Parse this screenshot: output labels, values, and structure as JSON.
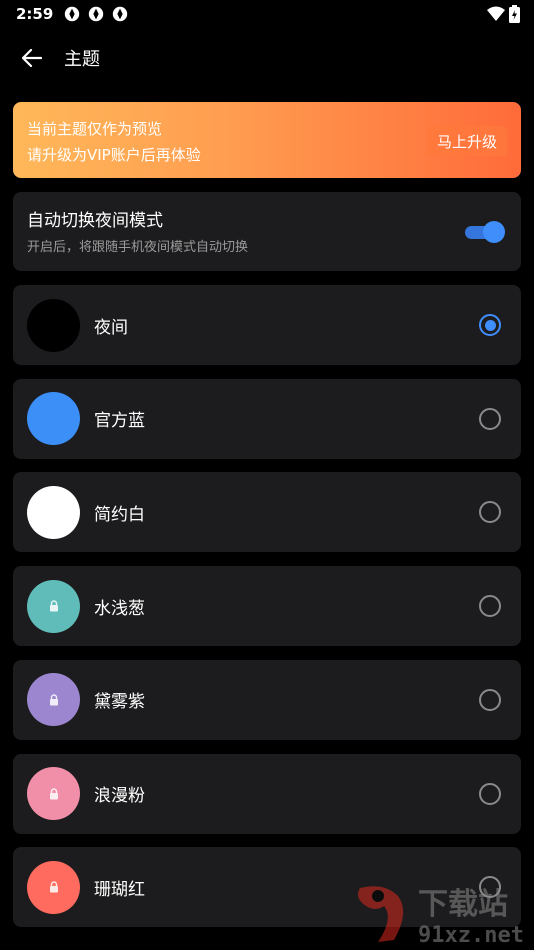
{
  "status": {
    "time": "2:59",
    "battery_glyph": "⚡"
  },
  "appbar": {
    "title": "主题"
  },
  "banner": {
    "line1": "当前主题仅作为预览",
    "line2": "请升级为VIP账户后再体验",
    "button": "马上升级"
  },
  "auto_night": {
    "title": "自动切换夜间模式",
    "subtitle": "开启后，将跟随手机夜间模式自动切换",
    "enabled": true
  },
  "themes": [
    {
      "name": "夜间",
      "color": "#000000",
      "locked": false,
      "selected": true
    },
    {
      "name": "官方蓝",
      "color": "#3b8ff6",
      "locked": false,
      "selected": false
    },
    {
      "name": "简约白",
      "color": "#ffffff",
      "locked": false,
      "selected": false
    },
    {
      "name": "水浅葱",
      "color": "#5fbcb8",
      "locked": true,
      "selected": false
    },
    {
      "name": "黛雾紫",
      "color": "#9b86cf",
      "locked": true,
      "selected": false
    },
    {
      "name": "浪漫粉",
      "color": "#f08fa7",
      "locked": true,
      "selected": false
    },
    {
      "name": "珊瑚红",
      "color": "#ff6b5e",
      "locked": true,
      "selected": false
    }
  ],
  "watermark": {
    "brand": "下载站",
    "domain": "91xz.net"
  }
}
